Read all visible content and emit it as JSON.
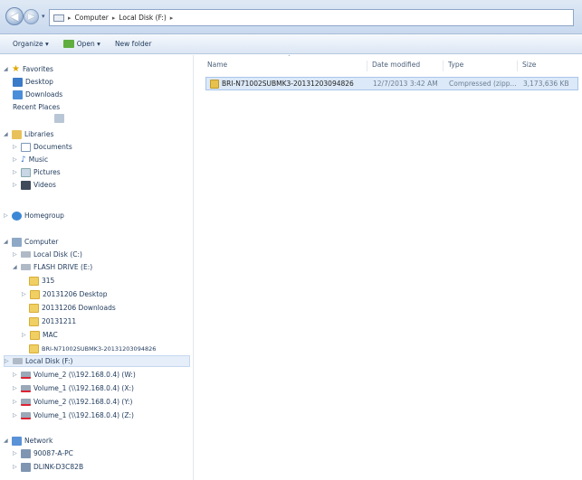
{
  "window": {
    "breadcrumb": [
      "Computer",
      "Local Disk (F:)"
    ]
  },
  "toolbar": {
    "organize": "Organize ▾",
    "open": "Open ▾",
    "new_folder": "New folder"
  },
  "nav": {
    "favorites": {
      "label": "Favorites",
      "items": [
        "Desktop",
        "Downloads",
        "Recent Places"
      ]
    },
    "libraries": {
      "label": "Libraries",
      "items": [
        "Documents",
        "Music",
        "Pictures",
        "Videos"
      ]
    },
    "homegroup": "Homegroup",
    "computer": {
      "label": "Computer",
      "local_c": "Local Disk (C:)",
      "flash": "FLASH DRIVE (E:)",
      "flash_items": [
        "315",
        "20131206 Desktop",
        "20131206 Downloads",
        "20131211",
        "MAC",
        "BRI-N71002SUBMK3-20131203094826"
      ],
      "local_f": "Local Disk (F:)",
      "network_drives": [
        "Volume_2 (\\\\192.168.0.4) (W:)",
        "Volume_1 (\\\\192.168.0.4) (X:)",
        "Volume_2 (\\\\192.168.0.4) (Y:)",
        "Volume_1 (\\\\192.168.0.4) (Z:)"
      ]
    },
    "network": {
      "label": "Network",
      "items": [
        "90087-A-PC",
        "DLINK-D3C82B"
      ]
    }
  },
  "content": {
    "columns": {
      "name": "Name",
      "date": "Date modified",
      "type": "Type",
      "size": "Size"
    },
    "files": [
      {
        "name": "BRI-N71002SUBMK3-20131203094826",
        "date": "12/7/2013 3:42 AM",
        "type": "Compressed (zipp...",
        "size": "3,173,636 KB"
      }
    ]
  },
  "colors": {
    "selection": "#dce9f8",
    "text": "#1e395b"
  }
}
